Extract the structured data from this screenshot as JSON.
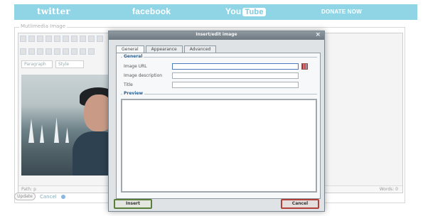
{
  "topbar": {
    "twitter": "twitter",
    "facebook": "facebook",
    "youtube_you": "You",
    "youtube_tube": "Tube",
    "donate": "DONATE NOW",
    "bar_color": "#8fd5e6"
  },
  "editor": {
    "legend": "Mutlimedia Image",
    "format_select": "Paragraph",
    "font_select": "Style",
    "path_label": "Path: p",
    "words_label": "Words: 0"
  },
  "actions": {
    "update_label": "Update",
    "cancel_label": "Cancel"
  },
  "dialog": {
    "title": "Insert/edit image",
    "close": "×",
    "tabs": [
      "General",
      "Appearance",
      "Advanced"
    ],
    "section_general": "General",
    "fields": [
      {
        "label": "Image URL",
        "value": ""
      },
      {
        "label": "Image description",
        "value": ""
      },
      {
        "label": "Title",
        "value": ""
      }
    ],
    "section_preview": "Preview",
    "insert_label": "Insert",
    "cancel_label": "Cancel"
  }
}
